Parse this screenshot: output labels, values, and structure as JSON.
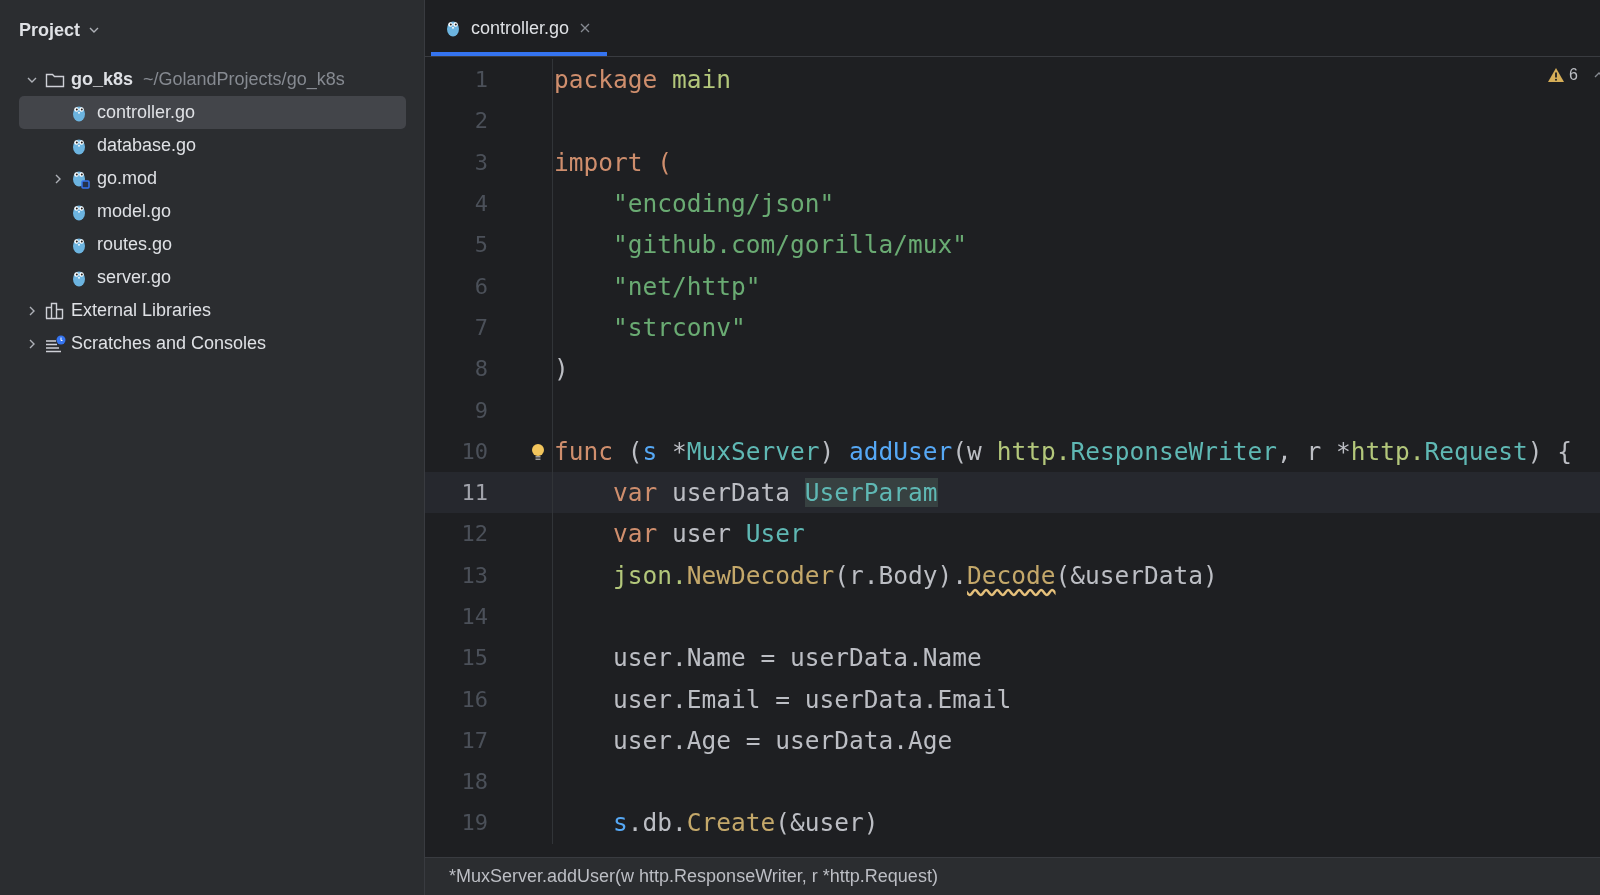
{
  "sidebar": {
    "title": "Project",
    "tree": [
      {
        "kind": "folder",
        "label": "go_k8s",
        "hint": "~/GolandProjects/go_k8s",
        "expanded": true,
        "selected": false,
        "children": [
          {
            "kind": "gofile",
            "label": "controller.go",
            "selected": true
          },
          {
            "kind": "gofile",
            "label": "database.go",
            "selected": false
          },
          {
            "kind": "gomod",
            "label": "go.mod",
            "expanded": false,
            "selected": false
          },
          {
            "kind": "gofile",
            "label": "model.go",
            "selected": false
          },
          {
            "kind": "gofile",
            "label": "routes.go",
            "selected": false
          },
          {
            "kind": "gofile",
            "label": "server.go",
            "selected": false
          }
        ]
      },
      {
        "kind": "libraries",
        "label": "External Libraries",
        "expanded": false,
        "selected": false
      },
      {
        "kind": "scratches",
        "label": "Scratches and Consoles",
        "expanded": false,
        "selected": false
      }
    ]
  },
  "tabs": [
    {
      "label": "controller.go",
      "selected": true
    }
  ],
  "inspections": {
    "warnings": "6"
  },
  "editor": {
    "lines": [
      {
        "number": "1",
        "current": false,
        "tokens": [
          {
            "text": "package ",
            "kind": "kw"
          },
          {
            "text": "main",
            "kind": "pkg"
          }
        ]
      },
      {
        "number": "2",
        "current": false
      },
      {
        "number": "3",
        "current": false,
        "tokens": [
          {
            "text": "import (",
            "kind": "kw"
          }
        ]
      },
      {
        "number": "4",
        "current": false,
        "tokens": [
          {
            "text": "    \"encoding/json\"",
            "kind": "str"
          }
        ]
      },
      {
        "number": "5",
        "current": false,
        "tokens": [
          {
            "text": "    \"github.com/gorilla/mux\"",
            "kind": "str"
          }
        ]
      },
      {
        "number": "6",
        "current": false,
        "tokens": [
          {
            "text": "    \"net/http\"",
            "kind": "str"
          }
        ]
      },
      {
        "number": "7",
        "current": false,
        "tokens": [
          {
            "text": "    \"strconv\"",
            "kind": "str"
          }
        ]
      },
      {
        "number": "8",
        "current": false,
        "tokens": [
          {
            "text": ")",
            "kind": "plain"
          }
        ]
      },
      {
        "number": "9",
        "current": false
      },
      {
        "number": "10",
        "current": false,
        "bulb": true,
        "tokens": [
          {
            "text": "func",
            "kind": "kw"
          },
          {
            "text": " (",
            "kind": "plain"
          },
          {
            "text": "s",
            "kind": "recv"
          },
          {
            "text": " *",
            "kind": "plain"
          },
          {
            "text": "MuxServer",
            "kind": "type"
          },
          {
            "text": ") ",
            "kind": "plain"
          },
          {
            "text": "addUser",
            "kind": "fn"
          },
          {
            "text": "(w ",
            "kind": "plain"
          },
          {
            "text": "http.",
            "kind": "pkg"
          },
          {
            "text": "ResponseWriter",
            "kind": "type"
          },
          {
            "text": ", r *",
            "kind": "plain"
          },
          {
            "text": "http.",
            "kind": "pkg"
          },
          {
            "text": "Request",
            "kind": "type"
          },
          {
            "text": ") {",
            "kind": "plain"
          }
        ]
      },
      {
        "number": "11",
        "current": true,
        "tokens": [
          {
            "text": "    var",
            "kind": "kw"
          },
          {
            "text": " userData ",
            "kind": "plain"
          },
          {
            "text": "UserParam",
            "kind": "type",
            "highlighted": true
          }
        ]
      },
      {
        "number": "12",
        "current": false,
        "tokens": [
          {
            "text": "    var",
            "kind": "kw"
          },
          {
            "text": " user ",
            "kind": "plain"
          },
          {
            "text": "User",
            "kind": "type"
          }
        ]
      },
      {
        "number": "13",
        "current": false,
        "tokens": [
          {
            "text": "    json.",
            "kind": "pkg"
          },
          {
            "text": "NewDecoder",
            "kind": "call"
          },
          {
            "text": "(r.Body).",
            "kind": "plain"
          },
          {
            "text": "Decode",
            "kind": "call",
            "warning": true
          },
          {
            "text": "(&userData)",
            "kind": "plain"
          }
        ]
      },
      {
        "number": "14",
        "current": false
      },
      {
        "number": "15",
        "current": false,
        "tokens": [
          {
            "text": "    user.Name = userData.Name",
            "kind": "plain"
          }
        ]
      },
      {
        "number": "16",
        "current": false,
        "tokens": [
          {
            "text": "    user.Email = userData.Email",
            "kind": "plain"
          }
        ]
      },
      {
        "number": "17",
        "current": false,
        "tokens": [
          {
            "text": "    user.Age = userData.Age",
            "kind": "plain"
          }
        ]
      },
      {
        "number": "18",
        "current": false
      },
      {
        "number": "19",
        "current": false,
        "tokens": [
          {
            "text": "    s",
            "kind": "recv"
          },
          {
            "text": ".db.",
            "kind": "plain"
          },
          {
            "text": "Create",
            "kind": "call"
          },
          {
            "text": "(&user)",
            "kind": "plain"
          }
        ]
      }
    ]
  },
  "status_bar": {
    "text": "*MuxServer.addUser(w http.ResponseWriter, r *http.Request)"
  }
}
